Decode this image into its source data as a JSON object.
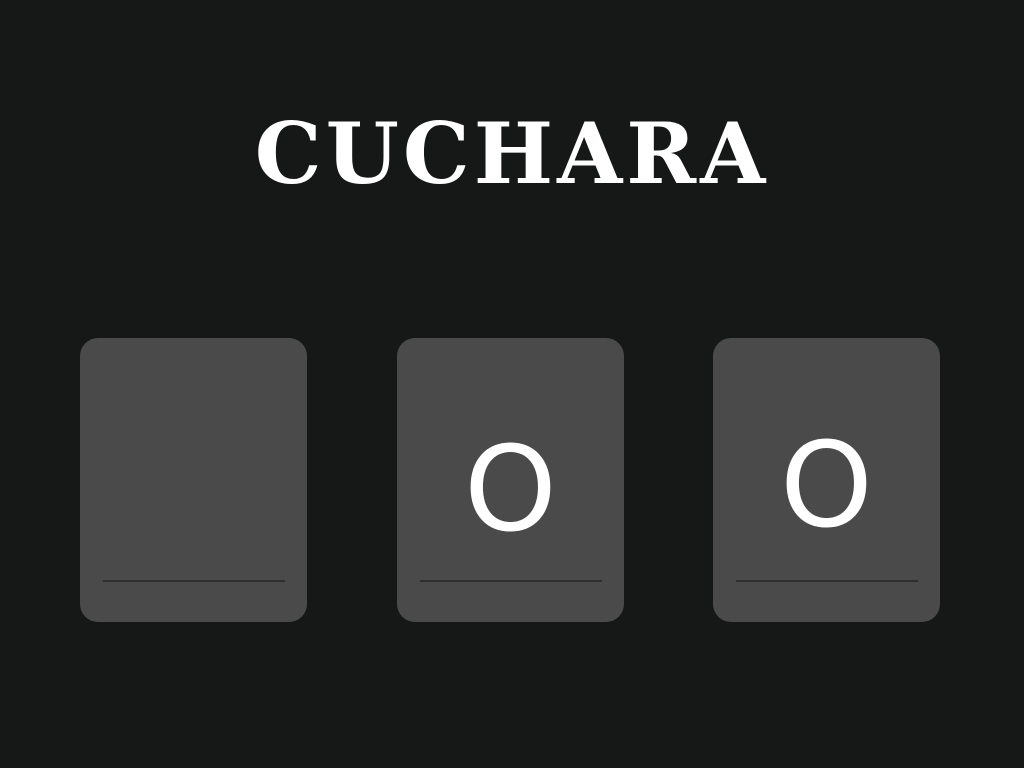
{
  "prompt": {
    "word": "CUCHARA"
  },
  "slots": [
    {
      "letter": ""
    },
    {
      "letter": "O"
    },
    {
      "letter": "O"
    }
  ]
}
